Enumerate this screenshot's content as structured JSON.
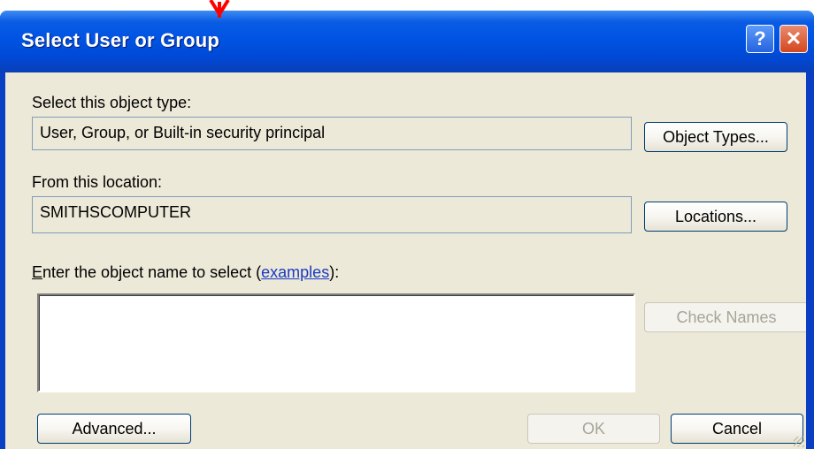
{
  "window": {
    "title": "Select User or Group",
    "help_glyph": "?",
    "close_glyph": "✕"
  },
  "object_type": {
    "label": "Select this object type:",
    "value": "User, Group, or Built-in security principal",
    "button": "Object Types..."
  },
  "location": {
    "label": "From this location:",
    "value": "SMITHSCOMPUTER",
    "button": "Locations..."
  },
  "object_name": {
    "label_prefix_underlined": "E",
    "label_prefix": "nter the object name to select (",
    "link_text": "examples",
    "label_suffix": "):",
    "value": ""
  },
  "buttons": {
    "check_names": "Check Names",
    "advanced": "Advanced...",
    "ok": "OK",
    "cancel": "Cancel"
  },
  "colors": {
    "titlebar": "#0054e3",
    "client_bg": "#ece9d8",
    "marker_arrow": "#ff0000"
  }
}
